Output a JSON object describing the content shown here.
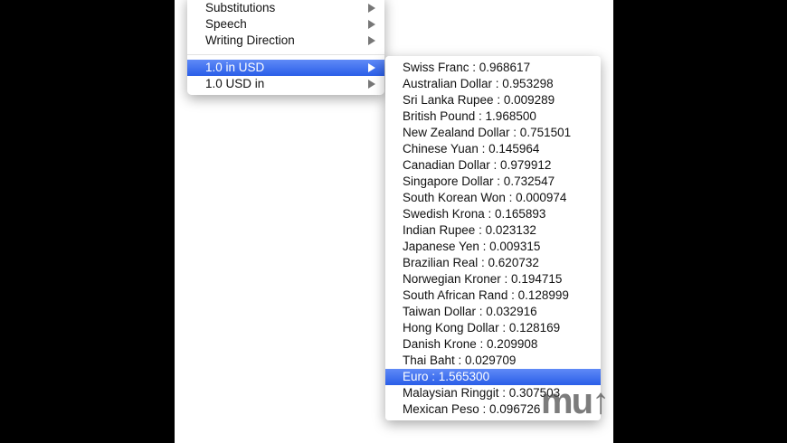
{
  "main_menu": {
    "items": [
      {
        "label": "Substitutions",
        "submenu": true
      },
      {
        "label": "Speech",
        "submenu": true
      },
      {
        "label": "Writing Direction",
        "submenu": true
      },
      {
        "label": "1.0 in USD",
        "submenu": true,
        "selected": true
      },
      {
        "label": "1.0 USD in",
        "submenu": true
      }
    ]
  },
  "submenu": {
    "items": [
      "Swiss Franc : 0.968617",
      "Australian Dollar : 0.953298",
      "Sri Lanka Rupee : 0.009289",
      "British Pound : 1.968500",
      "New Zealand Dollar : 0.751501",
      "Chinese Yuan : 0.145964",
      "Canadian Dollar : 0.979912",
      "Singapore Dollar : 0.732547",
      "South Korean Won : 0.000974",
      "Swedish Krona : 0.165893",
      "Indian Rupee : 0.023132",
      "Japanese Yen : 0.009315",
      "Brazilian Real : 0.620732",
      "Norwegian Kroner : 0.194715",
      "South African Rand : 0.128999",
      "Taiwan Dollar : 0.032916",
      "Hong Kong Dollar : 0.128169",
      "Danish Krone : 0.209908",
      "Thai Baht : 0.029709",
      "Euro : 1.565300",
      "Malaysian Ringgit : 0.307503",
      "Mexican Peso : 0.096726"
    ],
    "selected_index": 19
  },
  "watermark": "mu",
  "colors": {
    "highlight": "#3a6cf0"
  }
}
